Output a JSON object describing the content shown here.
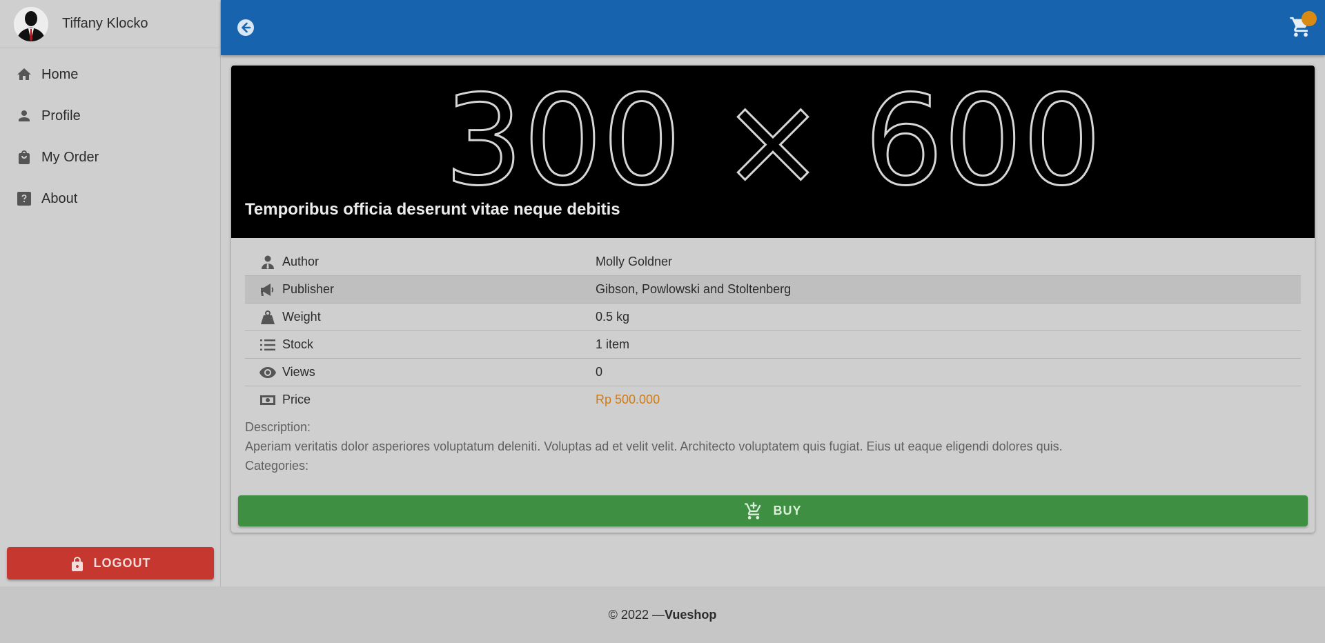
{
  "user": {
    "name": "Tiffany Klocko"
  },
  "sidebar": {
    "items": [
      {
        "label": "Home",
        "icon": "home-icon"
      },
      {
        "label": "Profile",
        "icon": "person-icon"
      },
      {
        "label": "My Order",
        "icon": "shopping-bag-icon"
      },
      {
        "label": "About",
        "icon": "help-icon"
      }
    ],
    "logout_label": "LOGOUT"
  },
  "topbar": {
    "back_icon": "arrow-left-circle-icon",
    "cart_icon": "cart-icon",
    "accent": "#1763ad",
    "badge_color": "#d98a12"
  },
  "product": {
    "image_placeholder": "300 × 600",
    "title": "Temporibus officia deserunt vitae neque debitis",
    "details": [
      {
        "label": "Author",
        "value": "Molly Goldner",
        "icon": "user-tie-icon"
      },
      {
        "label": "Publisher",
        "value": "Gibson, Powlowski and Stoltenberg",
        "icon": "megaphone-icon"
      },
      {
        "label": "Weight",
        "value": "0.5 kg",
        "icon": "weight-icon"
      },
      {
        "label": "Stock",
        "value": "1 item",
        "icon": "list-icon"
      },
      {
        "label": "Views",
        "value": "0",
        "icon": "eye-icon"
      },
      {
        "label": "Price",
        "value": "Rp 500.000",
        "icon": "money-icon"
      }
    ],
    "description_label": "Description:",
    "description": "Aperiam veritatis dolor asperiores voluptatum deleniti. Voluptas ad et velit velit. Architecto voluptatem quis fugiat. Eius ut eaque eligendi dolores quis.",
    "categories_label": "Categories:",
    "buy_label": "BUY",
    "price_color": "#d17a12",
    "buy_color": "#3e8f41"
  },
  "footer": {
    "copyright": "© 2022 — ",
    "brand": "Vueshop"
  }
}
